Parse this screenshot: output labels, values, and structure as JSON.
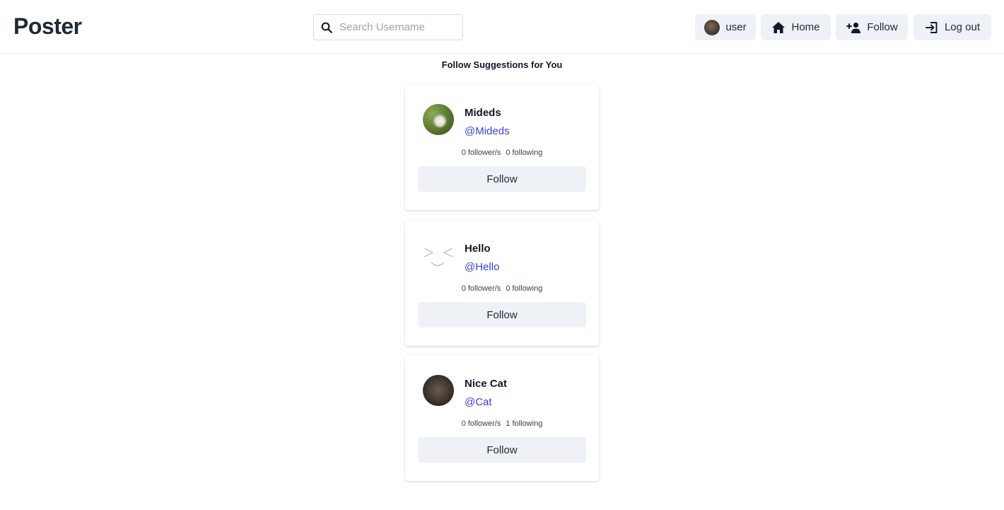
{
  "header": {
    "logo": "Poster",
    "search": {
      "placeholder": "Search Username",
      "value": ""
    },
    "nav": {
      "user_label": "user",
      "home_label": "Home",
      "follow_label": "Follow",
      "logout_label": "Log out"
    }
  },
  "main": {
    "heading": "Follow Suggestions for You",
    "suggestions": [
      {
        "name": "Mideds",
        "handle": "@Mideds",
        "followers": "0 follower/s",
        "following": "0 following",
        "button": "Follow",
        "avatar": "dog-photo"
      },
      {
        "name": "Hello",
        "handle": "@Hello",
        "followers": "0 follower/s",
        "following": "0 following",
        "button": "Follow",
        "avatar": "smiley-face"
      },
      {
        "name": "Nice Cat",
        "handle": "@Cat",
        "followers": "0 follower/s",
        "following": "1 following",
        "button": "Follow",
        "avatar": "cat-photo"
      }
    ]
  },
  "colors": {
    "accent_link": "#3b3fd8",
    "button_bg": "#eef1f5",
    "text": "#1f2937"
  }
}
